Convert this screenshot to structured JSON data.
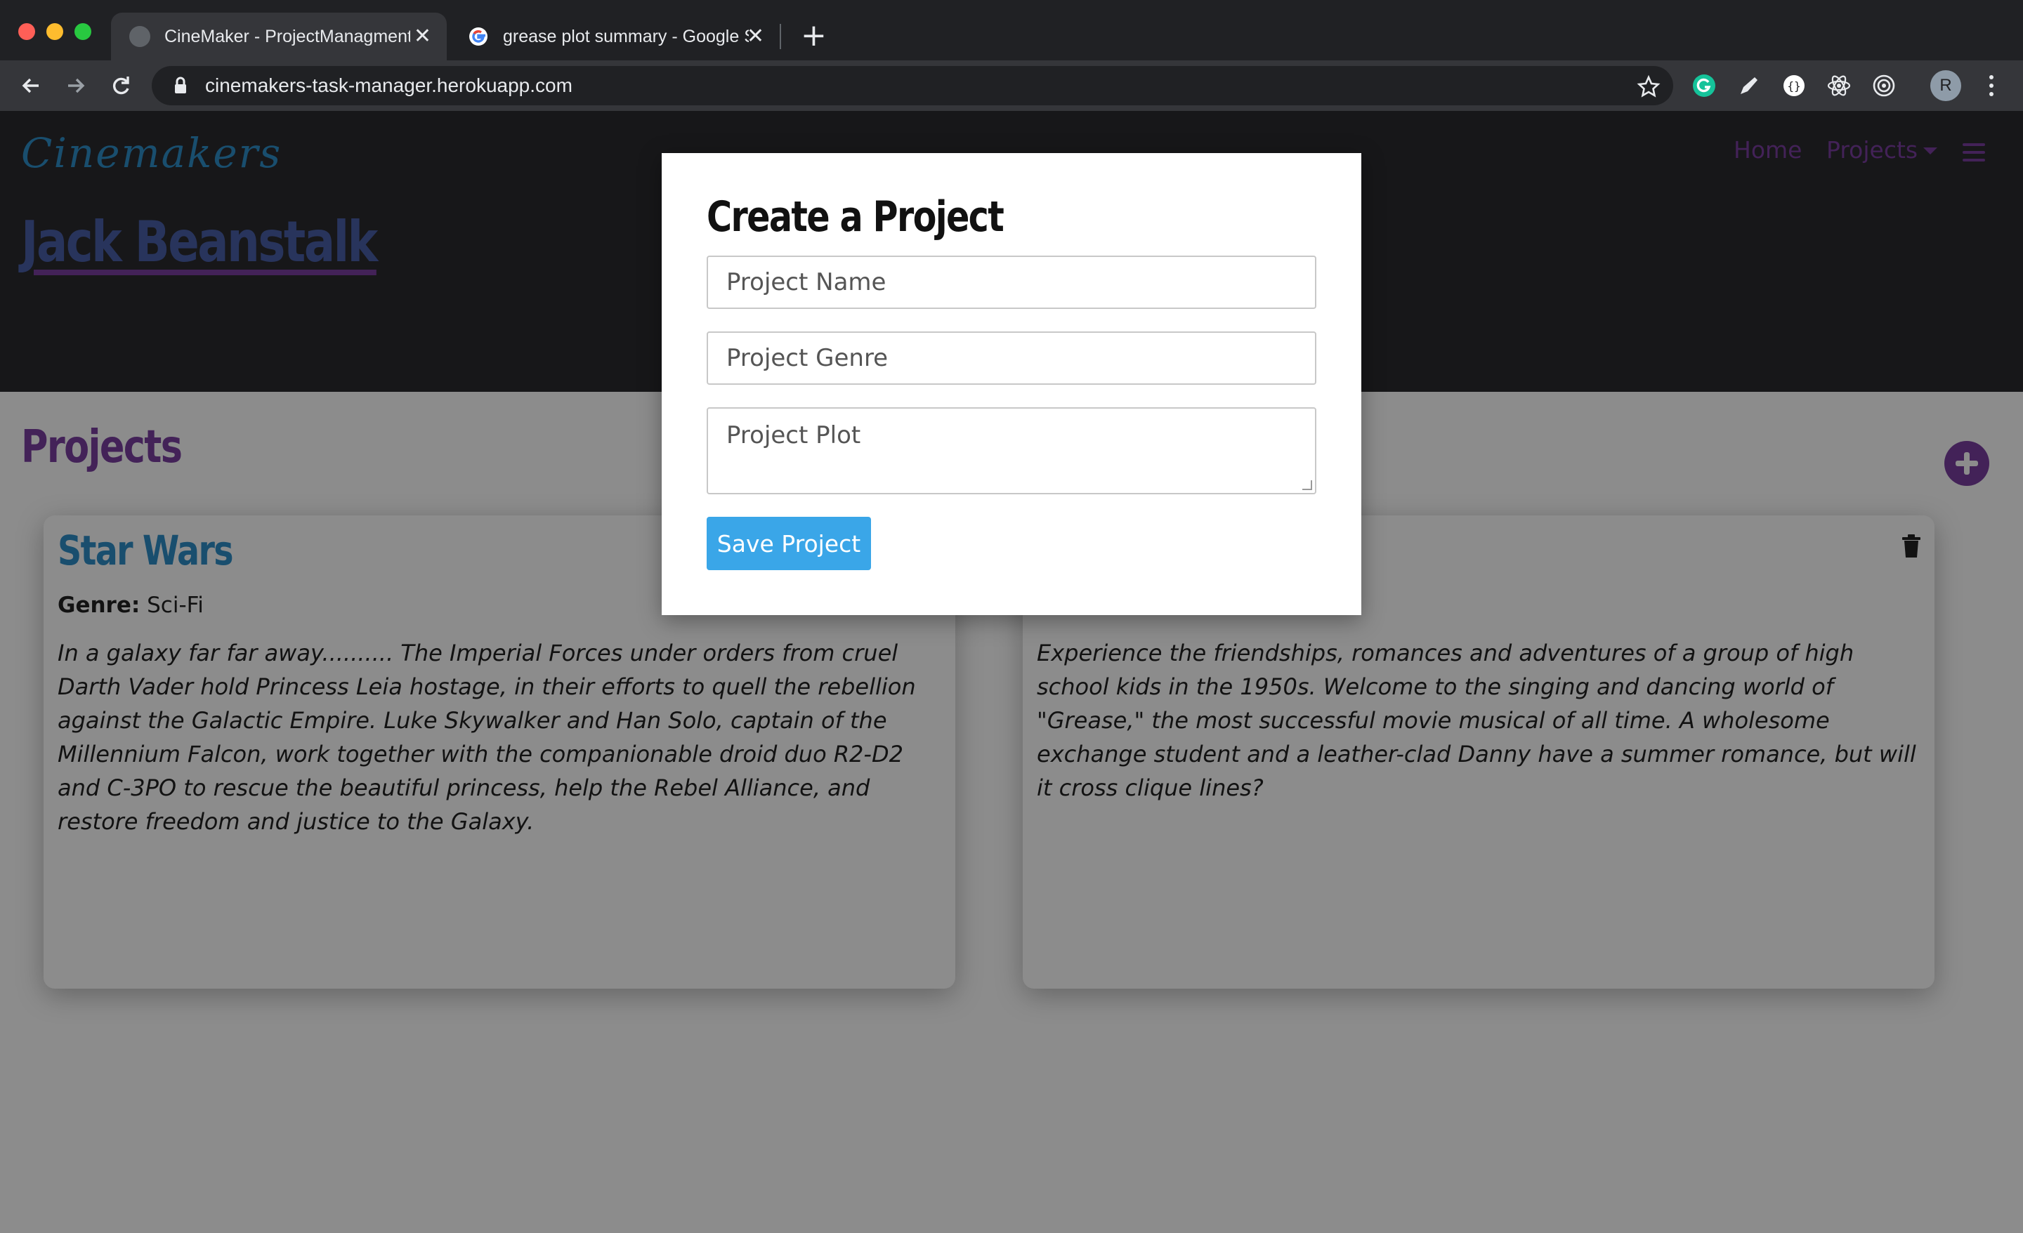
{
  "browser": {
    "tabs": [
      {
        "title": "CineMaker - ProjectManagment",
        "active": true
      },
      {
        "title": "grease plot summary - Google Search",
        "active": false
      }
    ],
    "url": "cinemakers-task-manager.herokuapp.com",
    "avatar_letter": "R"
  },
  "navbar": {
    "brand": "Cinemakers",
    "home_label": "Home",
    "projects_label": "Projects"
  },
  "header": {
    "title": "Jack Beanstalk"
  },
  "projects_section": {
    "title": "Projects",
    "cards": [
      {
        "title": "Star Wars",
        "genre_label": "Genre:",
        "genre": "Sci-Fi",
        "plot": "In a galaxy far far away.......... The Imperial Forces under orders from cruel Darth Vader hold Princess Leia hostage, in their efforts to quell the rebellion against the Galactic Empire. Luke Skywalker and Han Solo, captain of the Millennium Falcon, work together with the companionable droid duo R2-D2 and C-3PO to rescue the beautiful princess, help the Rebel Alliance, and restore freedom and justice to the Galaxy."
      },
      {
        "plot": "Experience the friendships, romances and adventures of a group of high school kids in the 1950s. Welcome to the singing and dancing world of \"Grease,\" the most successful movie musical of all time. A wholesome exchange student and a leather-clad Danny have a summer romance, but will it cross clique lines?"
      }
    ]
  },
  "modal": {
    "title": "Create a Project",
    "name_placeholder": "Project Name",
    "genre_placeholder": "Project Genre",
    "plot_placeholder": "Project Plot",
    "save_label": "Save Project"
  }
}
